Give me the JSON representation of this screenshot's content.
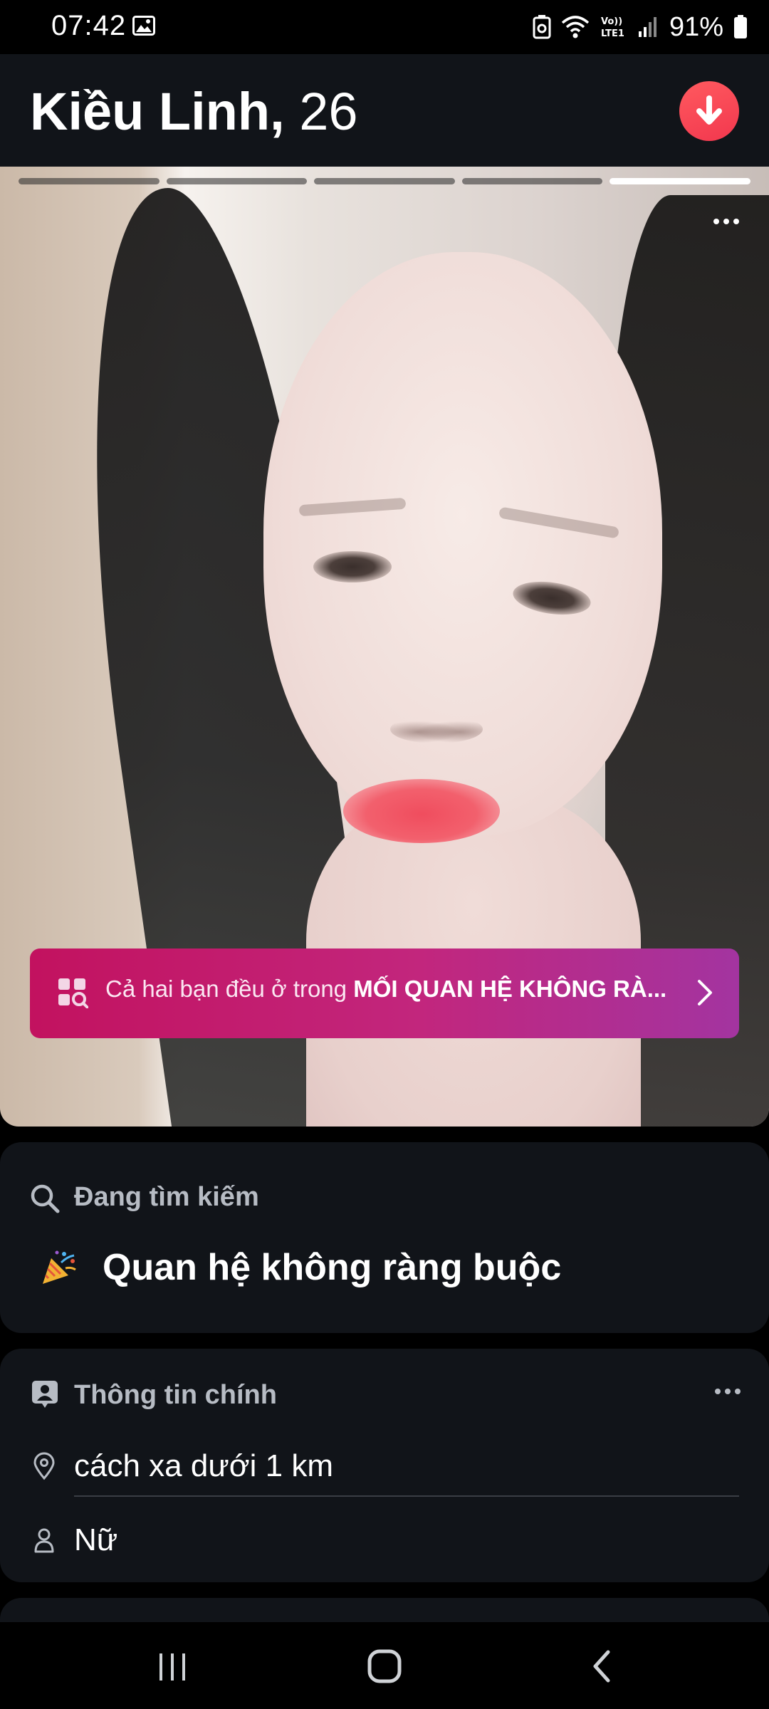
{
  "status_bar": {
    "time": "07:42",
    "battery_percent": "91%",
    "network_label": "Vo)) LTE1",
    "icons": [
      "gallery-icon",
      "data-saver-icon",
      "wifi-icon",
      "volte-lte-icon",
      "signal-icon",
      "battery-icon"
    ]
  },
  "profile": {
    "name": "Kiều Linh,",
    "age": "26",
    "action_icon": "arrow-down-icon",
    "accent_color": "#f2374e"
  },
  "photo": {
    "total_photos": 5,
    "active_index": 4,
    "more_icon": "more-dots-icon"
  },
  "banner": {
    "text_prefix": "Cả hai bạn đều ở trong",
    "text_highlight": "MỐI QUAN HỆ KHÔNG RÀ...",
    "icon": "search-grid-icon",
    "chevron": "chevron-right-icon",
    "gradient_start": "#c2125f",
    "gradient_end": "#a334a0"
  },
  "looking_for": {
    "heading": "Đang tìm kiếm",
    "icon": "search-icon",
    "value": "Quan hệ không ràng buộc",
    "value_icon": "party-popper-icon"
  },
  "basic_info": {
    "heading": "Thông tin chính",
    "icon": "person-badge-icon",
    "more_icon": "more-dots-icon",
    "rows": [
      {
        "icon": "location-pin-icon",
        "text": "cách xa dưới 1 km"
      },
      {
        "icon": "person-icon",
        "text": "Nữ"
      }
    ]
  },
  "nav_bar": {
    "buttons": [
      "recents-icon",
      "home-icon",
      "back-icon"
    ]
  }
}
